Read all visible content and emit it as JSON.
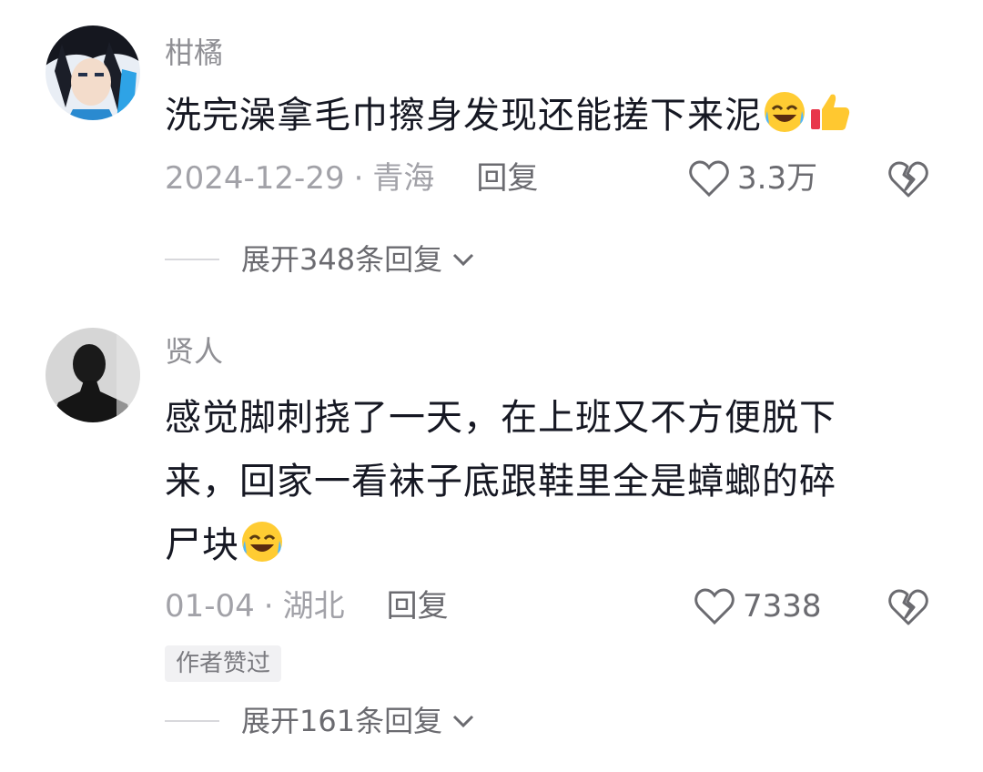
{
  "comments": [
    {
      "username": "柑橘",
      "text": "洗完澡拿毛巾擦身发现还能搓下来泥",
      "emojis": [
        "laughing-crying-emoji",
        "thumbs-up-emoji"
      ],
      "date": "2024-12-29",
      "location": "青海",
      "reply_label": "回复",
      "likes": "3.3万",
      "expand_label": "展开348条回复"
    },
    {
      "username": "贤人",
      "text_line1": "感觉脚刺挠了一天，在上班又不方便脱下",
      "text_line2": "来，回家一看袜子底跟鞋里全是蟑螂的碎",
      "text_line3": "尸块",
      "emojis": [
        "laughing-crying-emoji"
      ],
      "date": "01-04",
      "location": "湖北",
      "reply_label": "回复",
      "likes": "7338",
      "badge": "作者赞过",
      "expand_label": "展开161条回复"
    }
  ],
  "separator": "·",
  "icons": {
    "like": "heart-outline-icon",
    "dislike": "broken-heart-icon",
    "expand": "chevron-down-icon"
  },
  "colors": {
    "text": "#161823",
    "muted": "#a2a2a8",
    "badge_bg": "#f1f1f3"
  }
}
